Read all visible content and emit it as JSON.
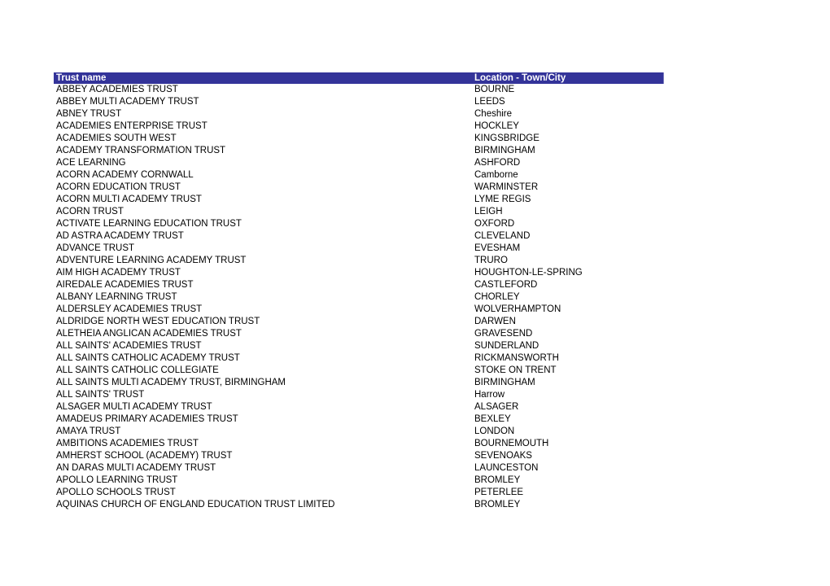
{
  "table": {
    "columns": [
      "Trust name",
      "Location  - Town/City"
    ],
    "header_color": "#333399",
    "rows": [
      [
        "ABBEY ACADEMIES TRUST",
        "BOURNE"
      ],
      [
        "ABBEY MULTI ACADEMY TRUST",
        "LEEDS"
      ],
      [
        "ABNEY TRUST",
        "Cheshire"
      ],
      [
        "ACADEMIES ENTERPRISE TRUST",
        "HOCKLEY"
      ],
      [
        "ACADEMIES SOUTH WEST",
        "KINGSBRIDGE"
      ],
      [
        "ACADEMY TRANSFORMATION TRUST",
        "BIRMINGHAM"
      ],
      [
        "ACE LEARNING",
        "ASHFORD"
      ],
      [
        "ACORN ACADEMY CORNWALL",
        "Camborne"
      ],
      [
        "ACORN EDUCATION TRUST",
        "WARMINSTER"
      ],
      [
        "ACORN MULTI ACADEMY TRUST",
        "LYME REGIS"
      ],
      [
        "ACORN TRUST",
        "LEIGH"
      ],
      [
        "ACTIVATE LEARNING EDUCATION TRUST",
        "OXFORD"
      ],
      [
        "AD ASTRA ACADEMY TRUST",
        "CLEVELAND"
      ],
      [
        "ADVANCE TRUST",
        "EVESHAM"
      ],
      [
        "ADVENTURE LEARNING ACADEMY TRUST",
        "TRURO"
      ],
      [
        "AIM HIGH ACADEMY TRUST",
        "HOUGHTON-LE-SPRING"
      ],
      [
        "AIREDALE ACADEMIES TRUST",
        "CASTLEFORD"
      ],
      [
        "ALBANY LEARNING TRUST",
        "CHORLEY"
      ],
      [
        "ALDERSLEY ACADEMIES TRUST",
        "WOLVERHAMPTON"
      ],
      [
        "ALDRIDGE NORTH WEST EDUCATION TRUST",
        "DARWEN"
      ],
      [
        "ALETHEIA ANGLICAN ACADEMIES TRUST",
        "GRAVESEND"
      ],
      [
        "ALL SAINTS' ACADEMIES TRUST",
        "SUNDERLAND"
      ],
      [
        "ALL SAINTS CATHOLIC ACADEMY TRUST",
        "RICKMANSWORTH"
      ],
      [
        "ALL SAINTS CATHOLIC COLLEGIATE",
        "STOKE ON TRENT"
      ],
      [
        "ALL SAINTS MULTI ACADEMY TRUST, BIRMINGHAM",
        "BIRMINGHAM"
      ],
      [
        "ALL SAINTS' TRUST",
        "Harrow"
      ],
      [
        "ALSAGER MULTI ACADEMY TRUST",
        "ALSAGER"
      ],
      [
        "AMADEUS PRIMARY ACADEMIES TRUST",
        "BEXLEY"
      ],
      [
        "AMAYA TRUST",
        "LONDON"
      ],
      [
        "AMBITIONS ACADEMIES TRUST",
        "BOURNEMOUTH"
      ],
      [
        "AMHERST SCHOOL (ACADEMY) TRUST",
        "SEVENOAKS"
      ],
      [
        "AN DARAS MULTI ACADEMY TRUST",
        "LAUNCESTON"
      ],
      [
        "APOLLO LEARNING TRUST",
        "BROMLEY"
      ],
      [
        "APOLLO SCHOOLS TRUST",
        "PETERLEE"
      ],
      [
        "AQUINAS CHURCH OF ENGLAND EDUCATION TRUST LIMITED",
        "BROMLEY"
      ]
    ]
  }
}
